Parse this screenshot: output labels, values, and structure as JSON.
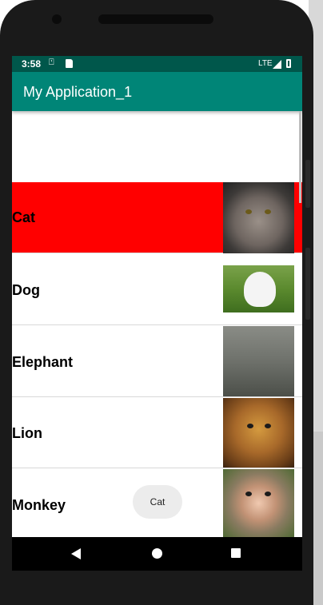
{
  "status_bar": {
    "time": "3:58",
    "network": "LTE"
  },
  "app_bar": {
    "title": "My Application_1"
  },
  "list": {
    "items": [
      {
        "label": "Cat",
        "image": "cat-photo",
        "selected": true
      },
      {
        "label": "Dog",
        "image": "dog-photo",
        "selected": false
      },
      {
        "label": "Elephant",
        "image": "elephant-photo",
        "selected": false
      },
      {
        "label": "Lion",
        "image": "lion-photo",
        "selected": false
      },
      {
        "label": "Monkey",
        "image": "monkey-photo",
        "selected": false
      }
    ]
  },
  "toast": {
    "text": "Cat"
  },
  "nav_bar": {
    "icons": [
      "back-icon",
      "home-icon",
      "recents-icon"
    ]
  },
  "colors": {
    "status_bar": "#00574b",
    "app_bar": "#008577",
    "selected_row": "#ff0000"
  }
}
